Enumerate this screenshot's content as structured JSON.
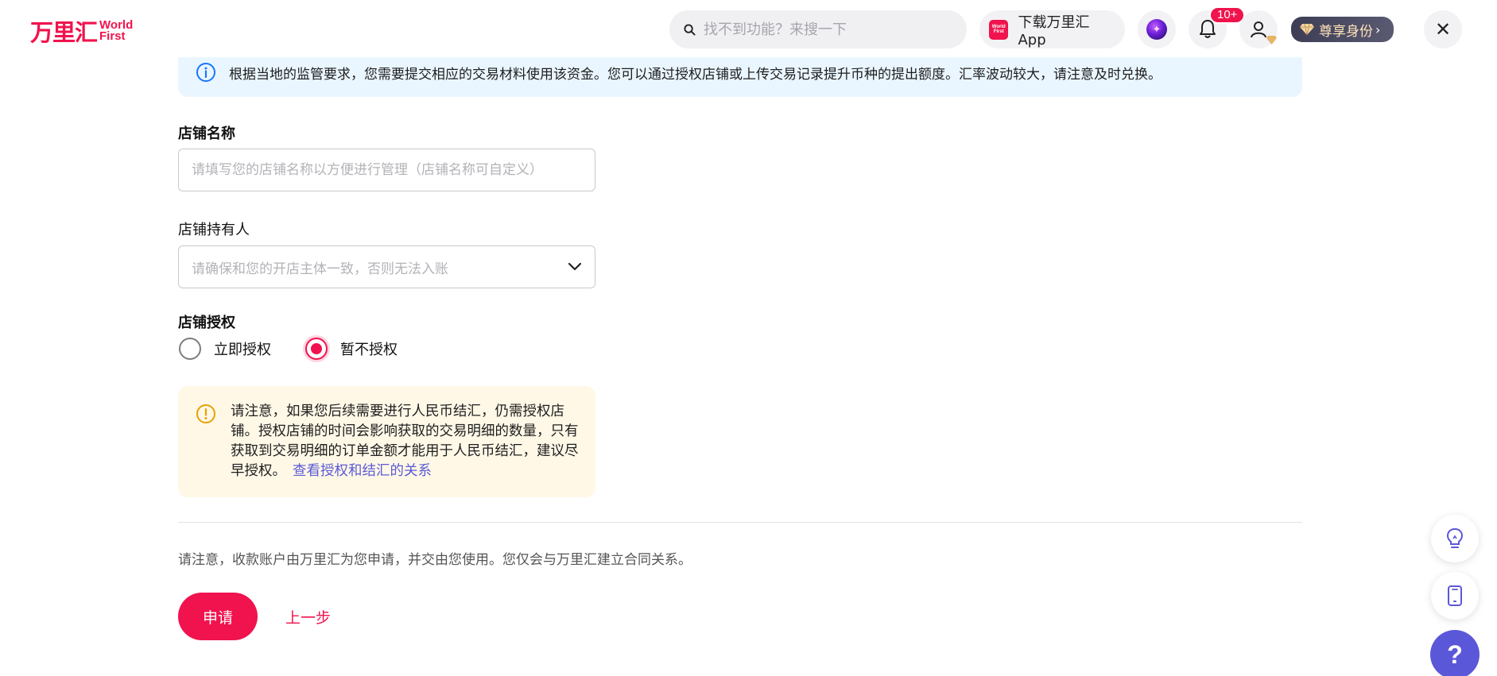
{
  "header": {
    "logo_cn": "万里汇",
    "logo_en_line1": "World",
    "logo_en_line2": "First",
    "search_placeholder": "找不到功能？来搜一下",
    "app_icon_line1": "World",
    "app_icon_line2": "First",
    "download_app_label": "下载万里汇App",
    "notification_count": "10+",
    "vip_label": "尊享身份",
    "vip_arrow": "›",
    "close_glyph": "✕"
  },
  "info_banner": {
    "text": "根据当地的监管要求，您需要提交相应的交易材料使用该资金。您可以通过授权店铺或上传交易记录提升币种的提出额度。汇率波动较大，请注意及时兑换。"
  },
  "form": {
    "store_name_label": "店铺名称",
    "store_name_placeholder": "请填写您的店铺名称以方便进行管理（店铺名称可自定义）",
    "store_name_value": "",
    "owner_label": "店铺持有人",
    "owner_placeholder": "请确保和您的开店主体一致，否则无法入账",
    "auth_label": "店铺授权",
    "auth_options": [
      {
        "label": "立即授权",
        "selected": false
      },
      {
        "label": "暂不授权",
        "selected": true
      }
    ]
  },
  "warning": {
    "text": "请注意，如果您后续需要进行人民币结汇，仍需授权店铺。授权店铺的时间会影响获取的交易明细的数量，只有获取到交易明细的订单金额才能用于人民币结汇，建议尽早授权。",
    "link": "查看授权和结汇的关系"
  },
  "footer": {
    "notice": "请注意，收款账户由万里汇为您申请，并交由您使用。您仅会与万里汇建立合同关系。",
    "submit_label": "申请",
    "back_label": "上一步"
  },
  "floating": {
    "help_glyph": "?"
  },
  "colors": {
    "brand": "#f0134d",
    "info_bg": "#eaf6ff",
    "warn_bg": "#fff8e7",
    "link": "#5b5bd6",
    "help_fab": "#5b57d9"
  },
  "icons": [
    "search-icon",
    "world-first-app-icon",
    "ai-assistant-icon",
    "bell-icon",
    "user-icon",
    "vip-diamond-icon",
    "close-icon",
    "info-icon",
    "chevron-down-icon",
    "warning-icon",
    "lightbulb-icon",
    "phone-icon",
    "help-icon"
  ]
}
